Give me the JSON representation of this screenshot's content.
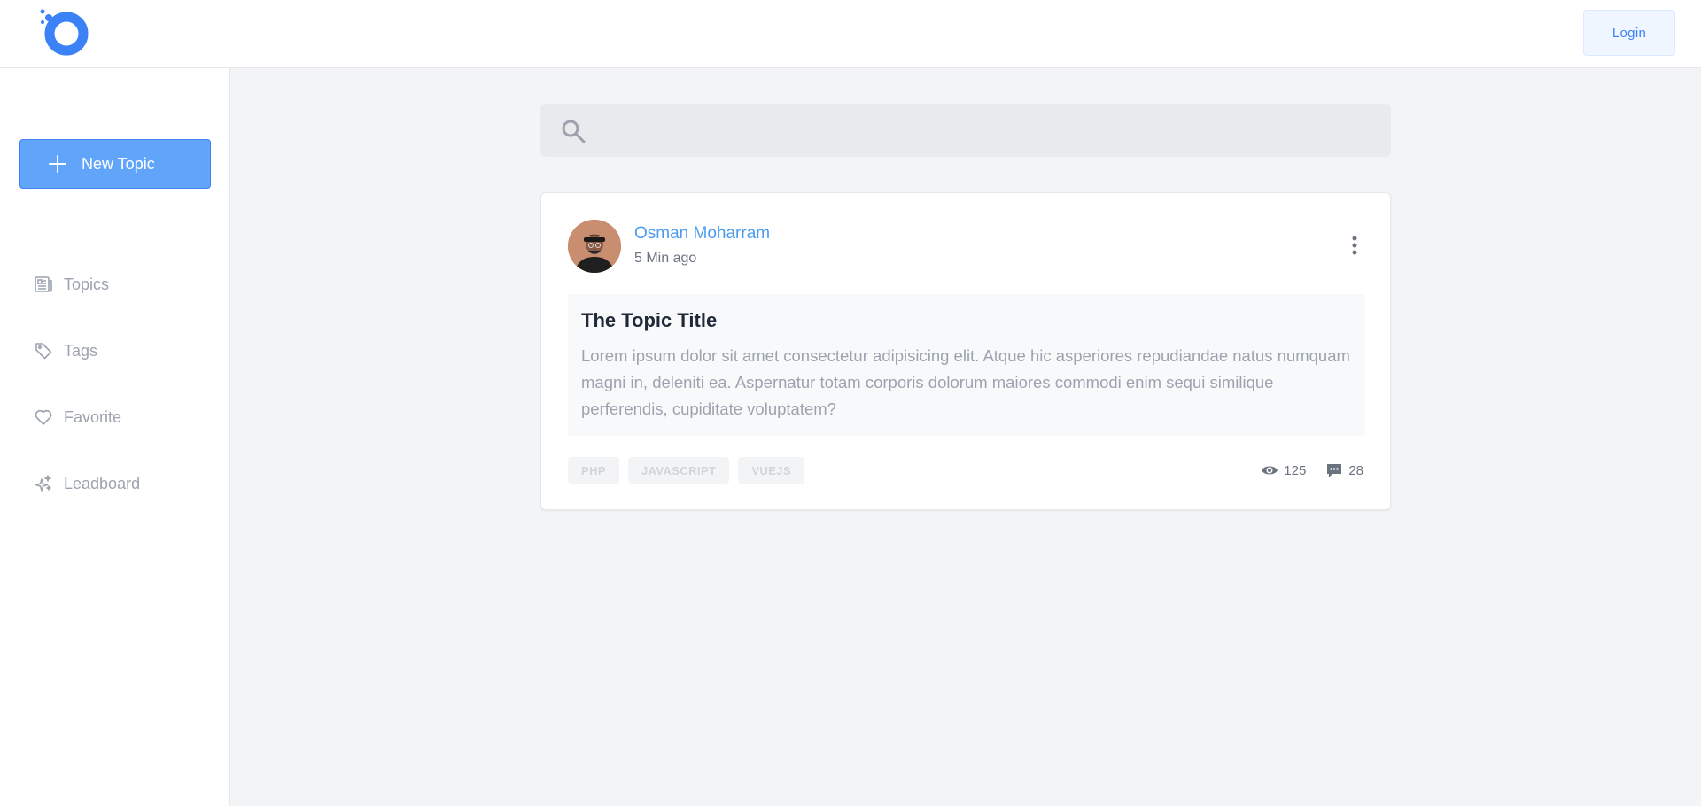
{
  "header": {
    "logo_icon": "app-logo",
    "login_label": "Login"
  },
  "sidebar": {
    "new_topic_label": "New Topic",
    "new_topic_icon": "plus-icon",
    "items": [
      {
        "label": "Topics",
        "icon": "newspaper-icon"
      },
      {
        "label": "Tags",
        "icon": "tag-icon"
      },
      {
        "label": "Favorite",
        "icon": "heart-icon"
      },
      {
        "label": "Leadboard",
        "icon": "sparkles-icon"
      }
    ]
  },
  "search": {
    "value": "",
    "icon": "search-icon"
  },
  "post": {
    "author": "Osman Moharram",
    "time": "5 Min ago",
    "title": "The Topic Title",
    "body": "Lorem ipsum dolor sit amet consectetur adipisicing elit. Atque hic asperiores repudiandae natus numquam magni in, deleniti ea. Aspernatur totam corporis dolorum maiores commodi enim sequi similique perferendis, cupiditate voluptatem?",
    "tags": [
      "PHP",
      "JAVASCRIPT",
      "VUEJS"
    ],
    "views": "125",
    "comments": "28"
  },
  "colors": {
    "accent": "#3b82f6",
    "button_fill": "#60a5fa",
    "author_link": "#4b9cf0",
    "page_bg": "#f3f4f6"
  }
}
